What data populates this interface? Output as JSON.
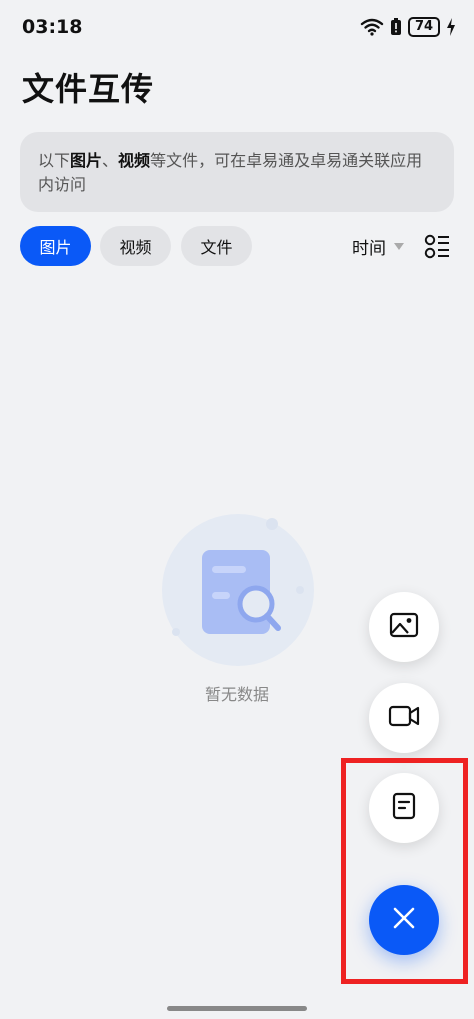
{
  "status_bar": {
    "time": "03:18",
    "battery": "74",
    "icons": [
      "wifi-icon",
      "alert-icon",
      "battery-icon",
      "charging-icon"
    ]
  },
  "header": {
    "title": "文件互传"
  },
  "info": {
    "prefix": "以下",
    "images": "图片",
    "sep": "、",
    "videos": "视频",
    "suffix": "等文件，可在卓易通及卓易通关联应用内访问"
  },
  "filters": {
    "images": "图片",
    "videos": "视频",
    "files": "文件",
    "active": "图片",
    "active_color": "#0a59f7"
  },
  "sort": {
    "label": "时间"
  },
  "empty_state": {
    "text": "暂无数据"
  },
  "fab": {
    "image_icon": "image-icon",
    "video_icon": "video-camera-icon",
    "doc_icon": "document-icon",
    "close_icon": "close-icon",
    "accent": "#0a59f7"
  },
  "highlight_color": "#ee2222"
}
